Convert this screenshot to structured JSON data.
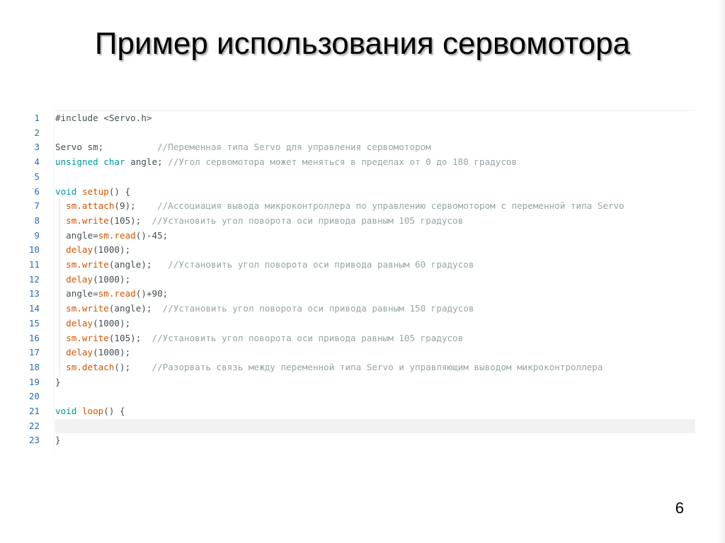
{
  "slide": {
    "title": "Пример использования сервомотора",
    "page_number": "6"
  },
  "editor": {
    "active_line": 22,
    "colors": {
      "keyword": "#00979d",
      "function": "#d35400",
      "number": "#005c5f",
      "comment": "#95a5a6",
      "text": "#434f54",
      "line_number": "#2b6cb0"
    },
    "lines": [
      {
        "n": "1",
        "t": [
          {
            "c": "txt",
            "s": "#include <Servo.h>"
          }
        ]
      },
      {
        "n": "2",
        "t": []
      },
      {
        "n": "3",
        "t": [
          {
            "c": "txt",
            "s": "Servo sm;          "
          },
          {
            "c": "cmt",
            "s": "//Переменная типа Servo для управления сервомотором"
          }
        ]
      },
      {
        "n": "4",
        "t": [
          {
            "c": "kw",
            "s": "unsigned char"
          },
          {
            "c": "txt",
            "s": " angle; "
          },
          {
            "c": "cmt",
            "s": "//Угол сервомотора может меняться в пределах от 0 до 180 градусов"
          }
        ]
      },
      {
        "n": "5",
        "t": []
      },
      {
        "n": "6",
        "t": [
          {
            "c": "kw",
            "s": "void"
          },
          {
            "c": "txt",
            "s": " "
          },
          {
            "c": "fn",
            "s": "setup"
          },
          {
            "c": "txt",
            "s": "() {"
          }
        ]
      },
      {
        "n": "7",
        "t": [
          {
            "c": "txt",
            "s": "  "
          },
          {
            "c": "fn",
            "s": "sm.attach"
          },
          {
            "c": "txt",
            "s": "(9);    "
          },
          {
            "c": "cmt",
            "s": "//Ассоциация вывода микроконтроллера по управлению сервомотором с переменной типа Servo"
          }
        ]
      },
      {
        "n": "8",
        "t": [
          {
            "c": "txt",
            "s": "  "
          },
          {
            "c": "fn",
            "s": "sm.write"
          },
          {
            "c": "txt",
            "s": "(105);  "
          },
          {
            "c": "cmt",
            "s": "//Установить угол поворота оси привода равным 105 градусов"
          }
        ]
      },
      {
        "n": "9",
        "t": [
          {
            "c": "txt",
            "s": "  angle="
          },
          {
            "c": "fn",
            "s": "sm.read"
          },
          {
            "c": "txt",
            "s": "()-45;"
          }
        ]
      },
      {
        "n": "10",
        "t": [
          {
            "c": "txt",
            "s": "  "
          },
          {
            "c": "fn",
            "s": "delay"
          },
          {
            "c": "txt",
            "s": "(1000);"
          }
        ]
      },
      {
        "n": "11",
        "t": [
          {
            "c": "txt",
            "s": "  "
          },
          {
            "c": "fn",
            "s": "sm.write"
          },
          {
            "c": "txt",
            "s": "(angle);   "
          },
          {
            "c": "cmt",
            "s": "//Установить угол поворота оси привода равным 60 градусов"
          }
        ]
      },
      {
        "n": "12",
        "t": [
          {
            "c": "txt",
            "s": "  "
          },
          {
            "c": "fn",
            "s": "delay"
          },
          {
            "c": "txt",
            "s": "(1000);"
          }
        ]
      },
      {
        "n": "13",
        "t": [
          {
            "c": "txt",
            "s": "  angle="
          },
          {
            "c": "fn",
            "s": "sm.read"
          },
          {
            "c": "txt",
            "s": "()+90;"
          }
        ]
      },
      {
        "n": "14",
        "t": [
          {
            "c": "txt",
            "s": "  "
          },
          {
            "c": "fn",
            "s": "sm.write"
          },
          {
            "c": "txt",
            "s": "(angle);  "
          },
          {
            "c": "cmt",
            "s": "//Установить угол поворота оси привода равным 150 градусов"
          }
        ]
      },
      {
        "n": "15",
        "t": [
          {
            "c": "txt",
            "s": "  "
          },
          {
            "c": "fn",
            "s": "delay"
          },
          {
            "c": "txt",
            "s": "(1000);"
          }
        ]
      },
      {
        "n": "16",
        "t": [
          {
            "c": "txt",
            "s": "  "
          },
          {
            "c": "fn",
            "s": "sm.write"
          },
          {
            "c": "txt",
            "s": "(105);  "
          },
          {
            "c": "cmt",
            "s": "//Установить угол поворота оси привода равным 105 градусов"
          }
        ]
      },
      {
        "n": "17",
        "t": [
          {
            "c": "txt",
            "s": "  "
          },
          {
            "c": "fn",
            "s": "delay"
          },
          {
            "c": "txt",
            "s": "(1000);"
          }
        ]
      },
      {
        "n": "18",
        "t": [
          {
            "c": "txt",
            "s": "  "
          },
          {
            "c": "fn",
            "s": "sm.detach"
          },
          {
            "c": "txt",
            "s": "();    "
          },
          {
            "c": "cmt",
            "s": "//Разорвать связь между переменной типа Servo и управляющим выводом микроконтроллера"
          }
        ]
      },
      {
        "n": "19",
        "t": [
          {
            "c": "txt",
            "s": "}"
          }
        ]
      },
      {
        "n": "20",
        "t": []
      },
      {
        "n": "21",
        "t": [
          {
            "c": "kw",
            "s": "void"
          },
          {
            "c": "txt",
            "s": " "
          },
          {
            "c": "fn",
            "s": "loop"
          },
          {
            "c": "txt",
            "s": "() {"
          }
        ]
      },
      {
        "n": "22",
        "t": []
      },
      {
        "n": "23",
        "t": [
          {
            "c": "txt",
            "s": "}"
          }
        ]
      }
    ]
  }
}
